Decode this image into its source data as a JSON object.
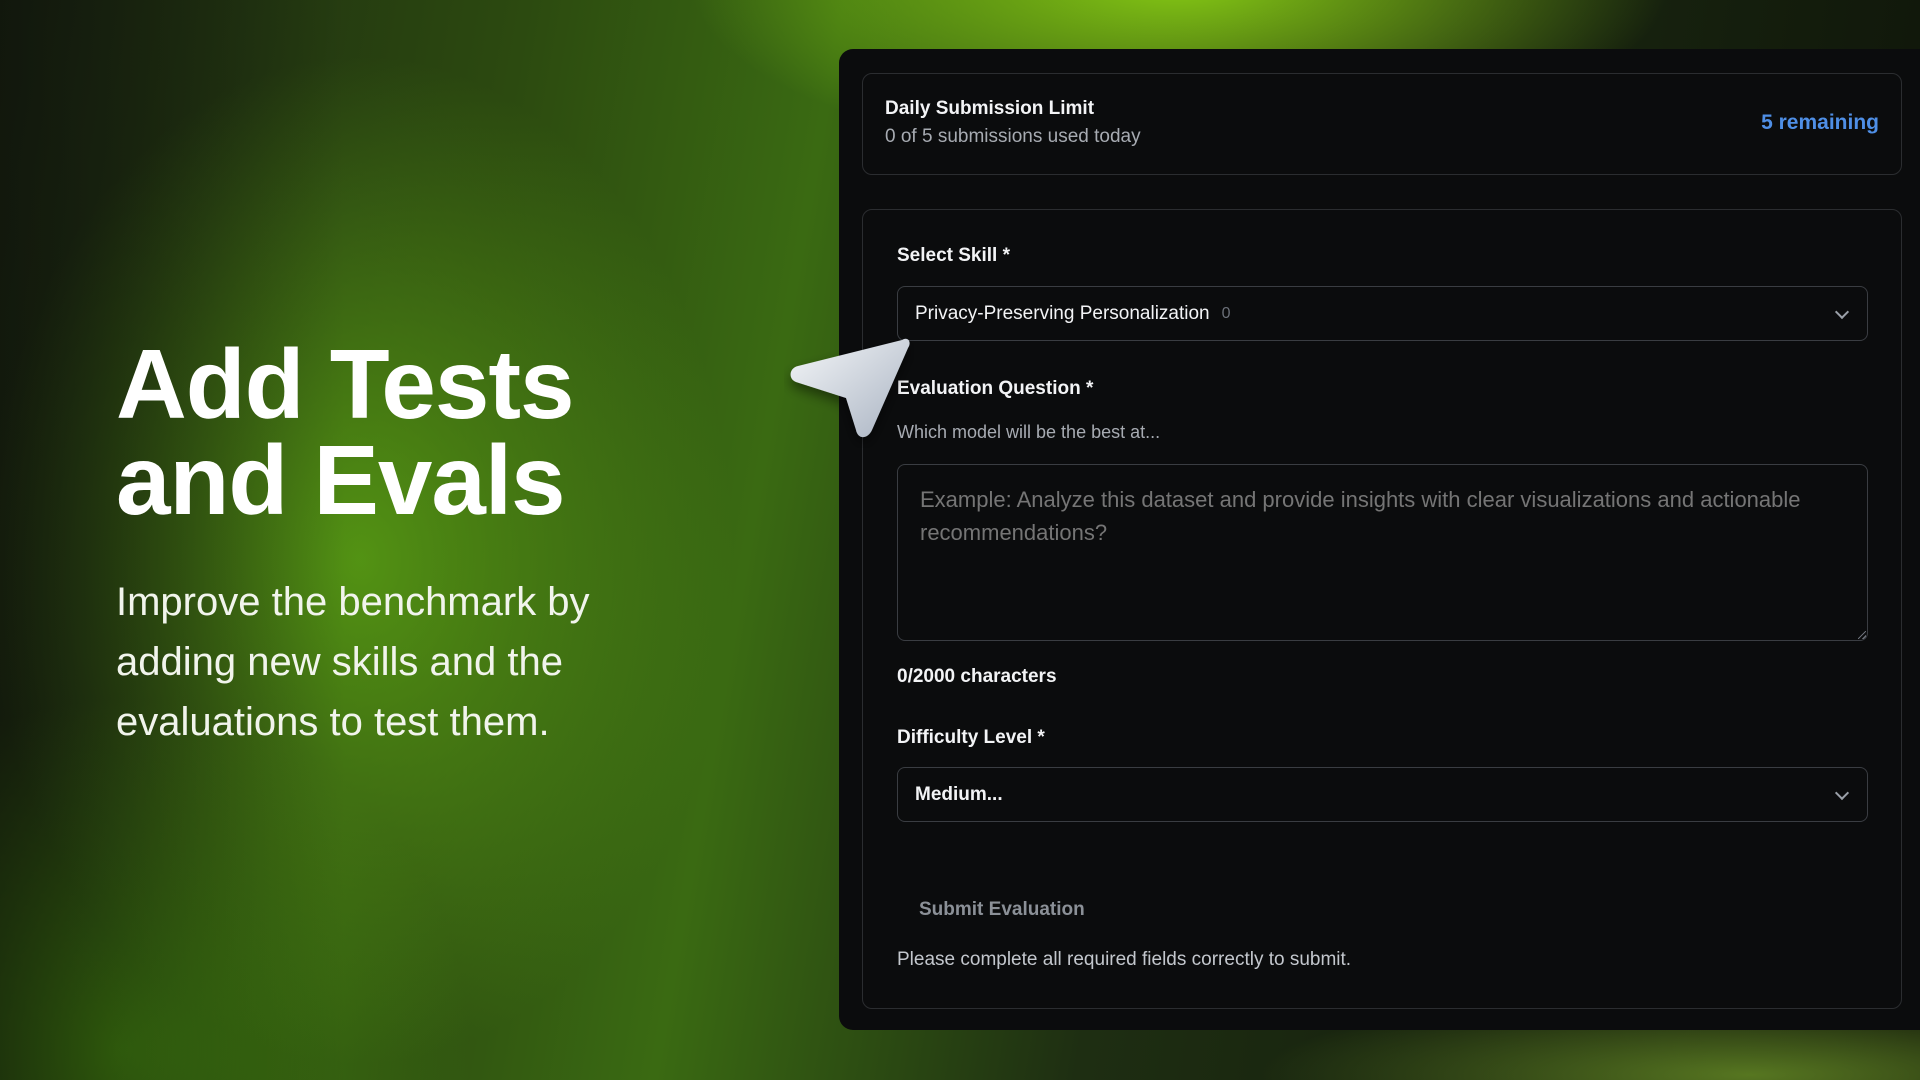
{
  "hero": {
    "title_line1": "Add Tests",
    "title_line2": "and Evals",
    "subtitle_line1": "Improve the benchmark by",
    "subtitle_line2": "adding new skills and the",
    "subtitle_line3": "evaluations to test them."
  },
  "limit": {
    "title": "Daily Submission Limit",
    "usage": "0 of 5 submissions used today",
    "remaining": "5 remaining"
  },
  "form": {
    "skill_label": "Select Skill *",
    "skill_value": "Privacy-Preserving Personalization",
    "skill_count": "0",
    "question_label": "Evaluation Question *",
    "question_hint": "Which model will be the best at...",
    "question_placeholder": "Example: Analyze this dataset and provide insights with clear visualizations and actionable recommendations?",
    "char_count": "0/2000 characters",
    "difficulty_label": "Difficulty Level *",
    "difficulty_value": "Medium...",
    "submit_label": "Submit Evaluation",
    "note": "Please complete all required fields correctly to submit."
  },
  "icons": {
    "cursor": "pointer-arrow-icon",
    "chevron": "chevron-down-icon"
  },
  "colors": {
    "accent_blue": "#4f8fe6",
    "panel_bg": "#0b0c0d",
    "brand_green": "#8cd214"
  }
}
